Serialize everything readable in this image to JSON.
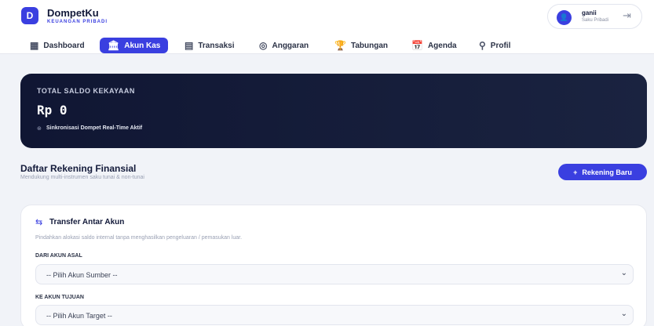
{
  "brand": {
    "logo_letter": "D",
    "name": "DompetKu",
    "subtitle": "KEUANGAN PRIBADI"
  },
  "user": {
    "avatar_glyph": "👤",
    "name": "ganii",
    "subtitle": "Saku Pribadi",
    "logout_icon": "logout-icon"
  },
  "nav": {
    "items": [
      {
        "label": "Dashboard",
        "icon": "dashboard-icon",
        "glyph": "▦",
        "active": false
      },
      {
        "label": "Akun Kas",
        "icon": "bank-icon",
        "glyph": "🏛",
        "active": true
      },
      {
        "label": "Transaksi",
        "icon": "receipt-icon",
        "glyph": "▤",
        "active": false
      },
      {
        "label": "Anggaran",
        "icon": "target-icon",
        "glyph": "◎",
        "active": false
      },
      {
        "label": "Tabungan",
        "icon": "trophy-icon",
        "glyph": "🏆",
        "active": false
      },
      {
        "label": "Agenda",
        "icon": "calendar-icon",
        "glyph": "📅",
        "active": false
      },
      {
        "label": "Profil",
        "icon": "user-icon",
        "glyph": "⚲",
        "active": false
      }
    ]
  },
  "balance": {
    "label": "TOTAL SALDO KEKAYAAN",
    "value": "Rp 0",
    "sync_text": "Sinkronisasi Dompet Real-Time Aktif"
  },
  "accounts": {
    "title": "Daftar Rekening Finansial",
    "subtitle": "Mendukung multi-instrumen saku tunai & non-tunai",
    "new_button": "Rekening Baru",
    "new_button_icon": "+"
  },
  "transfer": {
    "icon": "⇆",
    "title": "Transfer Antar Akun",
    "description": "Pindahkan alokasi saldo internal tanpa menghasilkan pengeluaran / pemasukan luar.",
    "from_label": "DARI AKUN ASAL",
    "from_value": "-- Pilih Akun Sumber --",
    "to_label": "KE AKUN TUJUAN",
    "to_value": "-- Pilih Akun Target --"
  },
  "colors": {
    "accent": "#3a3fe0",
    "dark_card": "#101633",
    "background": "#f1f3f8"
  }
}
